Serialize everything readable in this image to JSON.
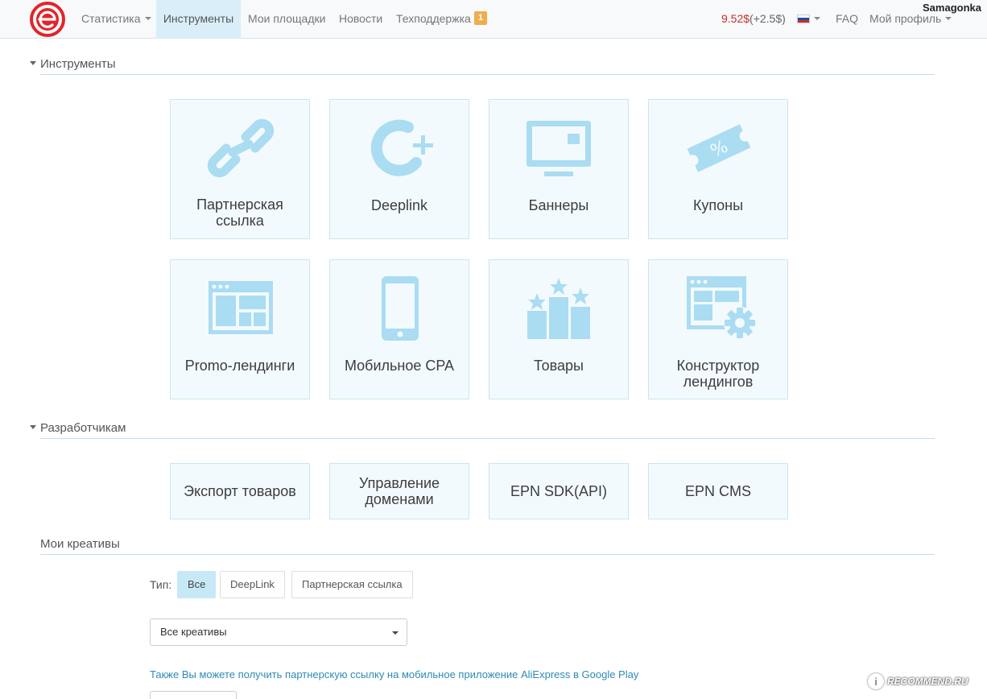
{
  "nav": {
    "items": [
      {
        "label": "Статистика"
      },
      {
        "label": "Инструменты"
      },
      {
        "label": "Мои площадки"
      },
      {
        "label": "Новости"
      },
      {
        "label": "Техподдержка",
        "badge": "1"
      }
    ],
    "balance": "9.52$",
    "balance_delta": "(+2.5$)",
    "faq": "FAQ",
    "profile": "Мой профиль",
    "username": "Samagonka"
  },
  "tools": {
    "title": "Инструменты",
    "tiles": [
      {
        "label": "Партнерская ссылка",
        "icon": "link-icon"
      },
      {
        "label": "Deeplink",
        "icon": "deeplink-icon"
      },
      {
        "label": "Баннеры",
        "icon": "monitor-icon"
      },
      {
        "label": "Купоны",
        "icon": "coupon-icon"
      },
      {
        "label": "Promo-лендинги",
        "icon": "landing-page-icon"
      },
      {
        "label": "Мобильное CPA",
        "icon": "smartphone-icon"
      },
      {
        "label": "Товары",
        "icon": "products-stars-icon"
      },
      {
        "label": "Конструктор лендингов",
        "icon": "landing-builder-icon"
      }
    ]
  },
  "developers": {
    "title": "Разработчикам",
    "tiles": [
      {
        "label": "Экспорт товаров"
      },
      {
        "label": "Управление доменами"
      },
      {
        "label": "EPN SDK(API)"
      },
      {
        "label": "EPN CMS"
      }
    ]
  },
  "creatives": {
    "title": "Мои креативы",
    "type_label": "Тип:",
    "filters": [
      {
        "label": "Все",
        "selected": true
      },
      {
        "label": "DeepLink",
        "selected": false
      },
      {
        "label": "Партнерская ссылка",
        "selected": false
      }
    ],
    "select_value": "Все креативы",
    "google_play_note": "Также Вы можете получить партнерскую ссылку на мобильное приложение AliExpress в Google Play"
  },
  "watermark": "RECOMMEND.RU",
  "colors": {
    "accent": "#bfe6f5",
    "tile_bg": "#f3fafd",
    "icon": "#aadcf2",
    "logo": "#e2242b",
    "balance": "#c62f2f",
    "link": "#2d8bb5"
  }
}
